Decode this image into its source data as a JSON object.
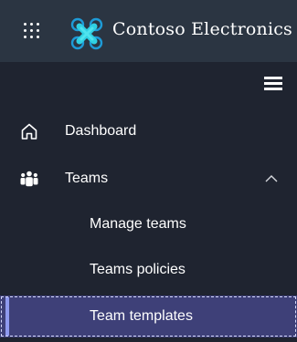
{
  "header": {
    "app_launcher_icon": "waffle-grid-icon",
    "logo_icon": "contoso-x-logo-icon",
    "brand_name": "Contoso Electronics",
    "background": "#2b3542"
  },
  "nav": {
    "background": "#1f2430",
    "collapse_icon": "hamburger-icon",
    "items": [
      {
        "label": "Dashboard",
        "icon": "home-icon"
      },
      {
        "label": "Teams",
        "icon": "people-team-icon",
        "expanded": true,
        "toggle_icon": "chevron-up-icon"
      }
    ],
    "sub_items": [
      {
        "label": "Manage teams",
        "selected": false
      },
      {
        "label": "Teams policies",
        "selected": false
      },
      {
        "label": "Team templates",
        "selected": true
      }
    ],
    "selected_background": "#3e4078",
    "selected_accent": "#8f9aef"
  }
}
